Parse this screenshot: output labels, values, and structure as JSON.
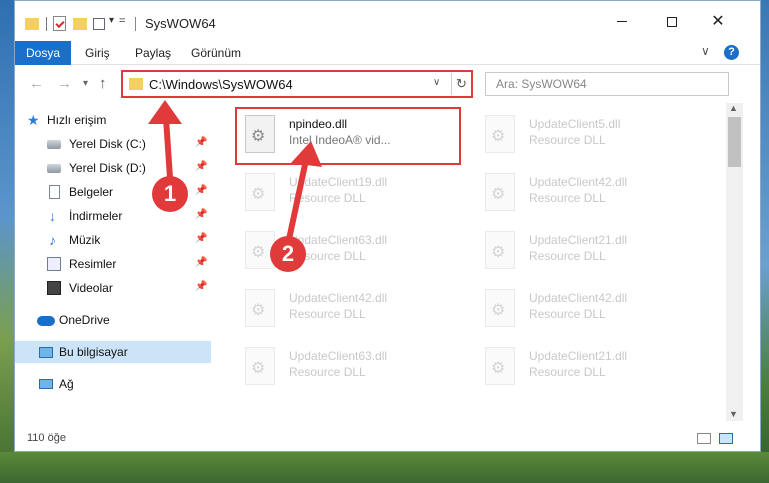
{
  "window": {
    "title": "SysWOW64"
  },
  "quick_access_toolbar": {
    "customize": "="
  },
  "ribbon": {
    "tabs": [
      "Dosya",
      "Giriş",
      "Paylaş",
      "Görünüm"
    ],
    "help": "?"
  },
  "address_bar": {
    "path": "C:\\Windows\\SysWOW64",
    "refresh": "↻",
    "dropdown": "⌄"
  },
  "search": {
    "placeholder": "Ara: SysWOW64"
  },
  "sidebar": {
    "quick_access": "Hızlı erişim",
    "items": [
      {
        "label": "Yerel Disk (C:)",
        "icon": "drive-icon",
        "pinned": true
      },
      {
        "label": "Yerel Disk (D:)",
        "icon": "drive-icon",
        "pinned": true
      },
      {
        "label": "Belgeler",
        "icon": "documents-icon",
        "pinned": true
      },
      {
        "label": "İndirmeler",
        "icon": "downloads-icon",
        "pinned": true
      },
      {
        "label": "Müzik",
        "icon": "music-icon",
        "pinned": true
      },
      {
        "label": "Resimler",
        "icon": "pictures-icon",
        "pinned": true
      },
      {
        "label": "Videolar",
        "icon": "videos-icon",
        "pinned": true
      }
    ],
    "onedrive": "OneDrive",
    "this_pc": "Bu bilgisayar",
    "network": "Ağ"
  },
  "files": [
    {
      "name": "npindeo.dll",
      "desc": "Intel IndeoA® vid...",
      "highlighted": true
    },
    {
      "name": "UpdateClient5.dll",
      "desc": "Resource DLL"
    },
    {
      "name": "UpdateClient19.dll",
      "desc": "Resource DLL"
    },
    {
      "name": "UpdateClient42.dll",
      "desc": "Resource DLL"
    },
    {
      "name": "UpdateClient63.dll",
      "desc": "Resource DLL"
    },
    {
      "name": "UpdateClient21.dll",
      "desc": "Resource DLL"
    },
    {
      "name": "UpdateClient42.dll",
      "desc": "Resource DLL"
    },
    {
      "name": "UpdateClient42.dll",
      "desc": "Resource DLL"
    },
    {
      "name": "UpdateClient63.dll",
      "desc": "Resource DLL"
    },
    {
      "name": "UpdateClient21.dll",
      "desc": "Resource DLL"
    }
  ],
  "status_bar": {
    "item_count": "110 öğe"
  },
  "annotations": {
    "step1": "1",
    "step2": "2",
    "color": "#e03a3a"
  },
  "colors": {
    "accent": "#1a6fc9",
    "selection": "#cce4f7"
  }
}
